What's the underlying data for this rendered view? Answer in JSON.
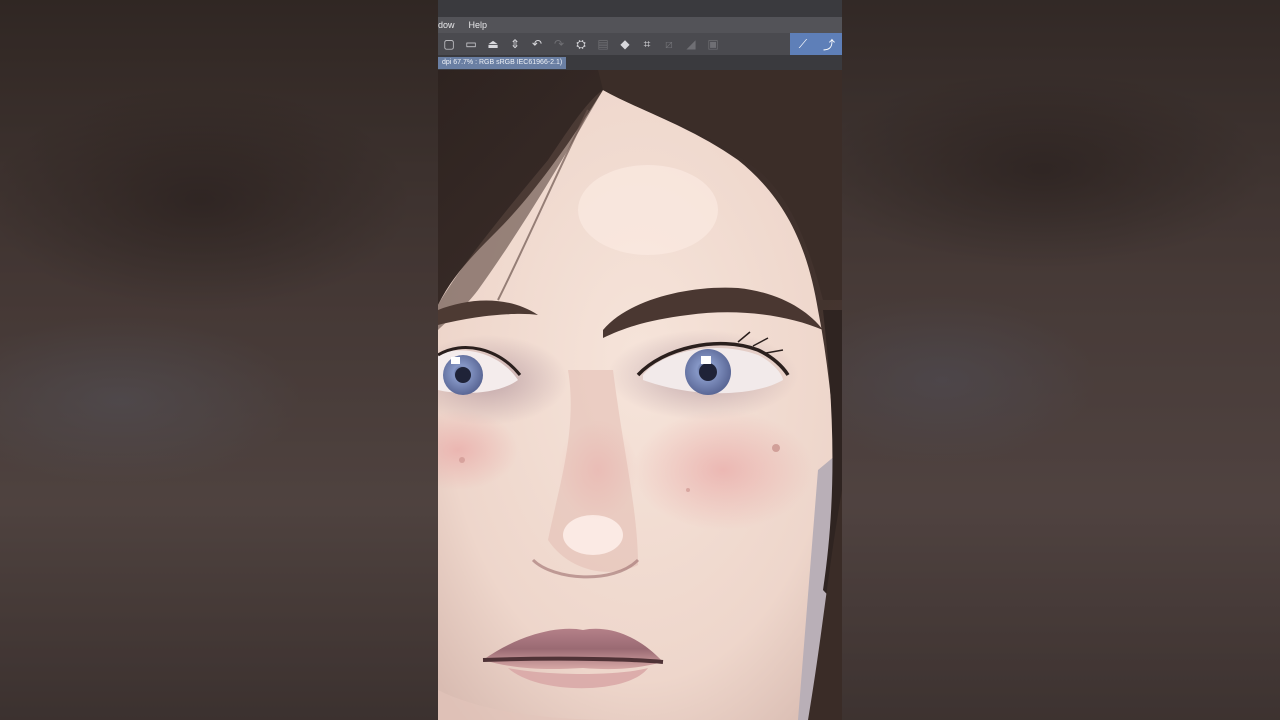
{
  "menu": {
    "window_label": "dow",
    "help_label": "Help"
  },
  "toolbar": {
    "icons": [
      "new-canvas",
      "open-file",
      "save",
      "export-stepper",
      "undo",
      "redo",
      "selection",
      "copy",
      "fill",
      "transform",
      "clear",
      "gradient",
      "frame",
      "pen-pressure",
      "stroke"
    ]
  },
  "tab": {
    "label": "dpi 67.7% : RGB sRGB IEC61966-2.1)"
  },
  "colors": {
    "menubar": "#535358",
    "toolbar": "#4a4a4f",
    "accent": "#5e7fb8",
    "skin": "#f0dcd2",
    "hair": "#3a2c27",
    "iris": "#7d8fbf"
  }
}
